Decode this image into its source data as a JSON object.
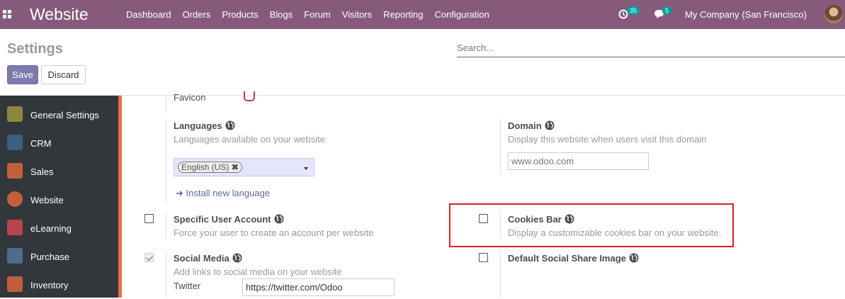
{
  "navbar": {
    "brand": "Website",
    "menu": [
      "Dashboard",
      "Orders",
      "Products",
      "Blogs",
      "Forum",
      "Visitors",
      "Reporting",
      "Configuration"
    ],
    "activity_count": "35",
    "message_count": "5",
    "company": "My Company (San Francisco)",
    "bg_color": "#875a7b"
  },
  "control": {
    "title": "Settings",
    "search_placeholder": "Search...",
    "save_label": "Save",
    "discard_label": "Discard"
  },
  "sidebar": {
    "items": [
      {
        "label": "General Settings",
        "icon": "gear-icon",
        "color": "#8a8a3c"
      },
      {
        "label": "CRM",
        "icon": "handshake-icon",
        "color": "#3b5f7e"
      },
      {
        "label": "Sales",
        "icon": "chart-icon",
        "color": "#c3603c"
      },
      {
        "label": "Website",
        "icon": "globe-icon",
        "color": "#c3603c"
      },
      {
        "label": "eLearning",
        "icon": "graduation-icon",
        "color": "#b8454e"
      },
      {
        "label": "Purchase",
        "icon": "purchase-icon",
        "color": "#4d6d8f"
      },
      {
        "label": "Inventory",
        "icon": "box-icon",
        "color": "#c35c3c"
      }
    ],
    "active": "Website"
  },
  "settings": {
    "favicon_label": "Favicon",
    "languages": {
      "title": "Languages",
      "description": "Languages available on your website",
      "selected_tag": "English (US)",
      "install_link": "Install new language"
    },
    "domain": {
      "title": "Domain",
      "description": "Display this website when users visit this domain",
      "placeholder": "www.odoo.com"
    },
    "specific_user_account": {
      "title": "Specific User Account",
      "description": "Force your user to create an account per website",
      "checked": false
    },
    "cookies_bar": {
      "title": "Cookies Bar",
      "description": "Display a customizable cookies bar on your website.",
      "checked": false
    },
    "social_media": {
      "title": "Social Media",
      "description": "Add links to social media on your website",
      "checked": true,
      "twitter_label": "Twitter",
      "twitter_value": "https://twitter.com/Odoo"
    },
    "default_social_share_image": {
      "title": "Default Social Share Image",
      "checked": false
    }
  }
}
